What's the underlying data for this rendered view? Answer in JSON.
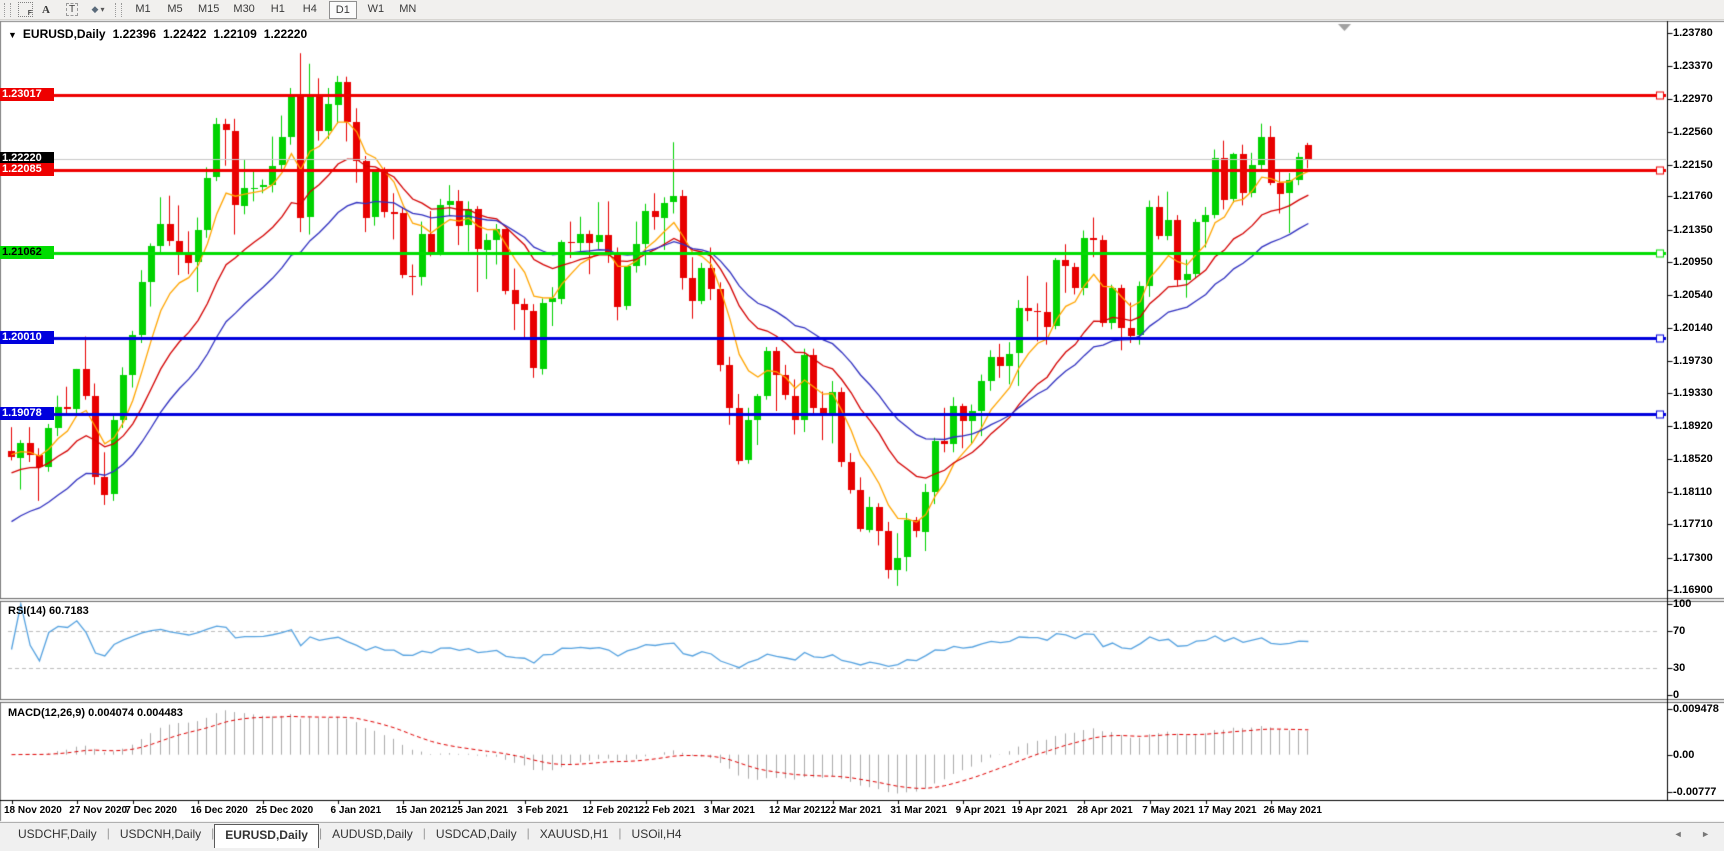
{
  "toolbar": {
    "grid_badge": "F",
    "font_tool": "A",
    "text_tool": "T",
    "shapes_glyph": "◆",
    "caret": "▾",
    "timeframes": [
      "M1",
      "M5",
      "M15",
      "M30",
      "H1",
      "H4",
      "D1",
      "W1",
      "MN"
    ],
    "active_timeframe": "D1"
  },
  "chart_header": {
    "dropdown": "▼",
    "symbol": "EURUSD,Daily",
    "open": "1.22396",
    "high": "1.22422",
    "low": "1.22109",
    "close": "1.22220"
  },
  "main_axis": {
    "ticks": [
      "1.23780",
      "1.23370",
      "1.22970",
      "1.22560",
      "1.22150",
      "1.21760",
      "1.21350",
      "1.20950",
      "1.20540",
      "1.20140",
      "1.19730",
      "1.19330",
      "1.18920",
      "1.18520",
      "1.18110",
      "1.17710",
      "1.17300",
      "1.16900"
    ]
  },
  "levels": [
    {
      "price": 1.23017,
      "label": "1.23017",
      "color": "#ee0000",
      "text_color": "#ffffff"
    },
    {
      "price": 1.22085,
      "label": "1.22085",
      "color": "#ee0000",
      "text_color": "#ffffff"
    },
    {
      "price": 1.21062,
      "label": "1.21062",
      "color": "#00dd00",
      "text_color": "#000000"
    },
    {
      "price": 1.2001,
      "label": "1.20010",
      "color": "#0000dd",
      "text_color": "#ffffff"
    },
    {
      "price": 1.19078,
      "label": "1.19078",
      "color": "#0000dd",
      "text_color": "#ffffff"
    }
  ],
  "current_price": {
    "price": 1.2222,
    "label": "1.22220",
    "line_color": "#c8c8c8",
    "bg": "#000000",
    "text_color": "#ffffff"
  },
  "rsi_panel": {
    "title": "RSI(14) 60.7183",
    "period": 14,
    "line_color": "#55a2e0",
    "level_color": "#bdbdbd",
    "ticks": [
      {
        "value": 100,
        "label": "100",
        "dashed": false
      },
      {
        "value": 70,
        "label": "70",
        "dashed": true
      },
      {
        "value": 30,
        "label": "30",
        "dashed": true
      },
      {
        "value": 0,
        "label": "0",
        "dashed": false
      }
    ]
  },
  "macd_panel": {
    "title": "MACD(12,26,9) 0.004074 0.004483",
    "fast": 12,
    "slow": 26,
    "signal": 9,
    "hist_color": "#ababab",
    "signal_color": "#e00000",
    "ticks": [
      {
        "value": 0.009478,
        "label": "0.009478"
      },
      {
        "value": 0.0,
        "label": "0.00"
      },
      {
        "value": -0.00777,
        "label": "-0.00777"
      }
    ]
  },
  "x_axis": {
    "labels": [
      {
        "text": "18 Nov 2020",
        "index": 0
      },
      {
        "text": "27 Nov 2020",
        "index": 7
      },
      {
        "text": "7 Dec 2020",
        "index": 13
      },
      {
        "text": "16 Dec 2020",
        "index": 20
      },
      {
        "text": "25 Dec 2020",
        "index": 27
      },
      {
        "text": "6 Jan 2021",
        "index": 35
      },
      {
        "text": "15 Jan 2021",
        "index": 42
      },
      {
        "text": "25 Jan 2021",
        "index": 48
      },
      {
        "text": "3 Feb 2021",
        "index": 55
      },
      {
        "text": "12 Feb 2021",
        "index": 62
      },
      {
        "text": "22 Feb 2021",
        "index": 68
      },
      {
        "text": "3 Mar 2021",
        "index": 75
      },
      {
        "text": "12 Mar 2021",
        "index": 82
      },
      {
        "text": "22 Mar 2021",
        "index": 88
      },
      {
        "text": "31 Mar 2021",
        "index": 95
      },
      {
        "text": "9 Apr 2021",
        "index": 102
      },
      {
        "text": "19 Apr 2021",
        "index": 108
      },
      {
        "text": "28 Apr 2021",
        "index": 115
      },
      {
        "text": "7 May 2021",
        "index": 122
      },
      {
        "text": "17 May 2021",
        "index": 128
      },
      {
        "text": "26 May 2021",
        "index": 135
      }
    ]
  },
  "tabs": {
    "items": [
      "USDCHF,Daily",
      "USDCNH,Daily",
      "EURUSD,Daily",
      "AUDUSD,Daily",
      "USDCAD,Daily",
      "XAUUSD,H1",
      "USOil,H4"
    ],
    "active": "EURUSD,Daily",
    "scroll_arrows": "◄ ►"
  },
  "shift_marker": "▼",
  "colors": {
    "candle_up": "#00d200",
    "candle_down": "#e80000",
    "ma_fast": "#ffa500",
    "ma_medium": "#d40000",
    "ma_slow": "#3030c0",
    "chart_bg": "#ffffff",
    "frame": "#808080"
  },
  "chart_data": {
    "type": "candlestick",
    "symbol": "EURUSD",
    "timeframe": "Daily",
    "price_axis_range": [
      1.168,
      1.23891
    ],
    "candles_ohlc": [
      [
        1.1862,
        1.1891,
        1.185,
        1.1854
      ],
      [
        1.1854,
        1.1875,
        1.1814,
        1.1872
      ],
      [
        1.1872,
        1.1891,
        1.1848,
        1.1857
      ],
      [
        1.1857,
        1.1865,
        1.18,
        1.1842
      ],
      [
        1.1842,
        1.1895,
        1.1836,
        1.189
      ],
      [
        1.189,
        1.193,
        1.188,
        1.1916
      ],
      [
        1.1916,
        1.1941,
        1.1906,
        1.1914
      ],
      [
        1.1914,
        1.1963,
        1.1908,
        1.1963
      ],
      [
        1.1963,
        1.2003,
        1.1925,
        1.193
      ],
      [
        1.193,
        1.1945,
        1.182,
        1.183
      ],
      [
        1.183,
        1.186,
        1.1795,
        1.1808
      ],
      [
        1.1808,
        1.1905,
        1.18,
        1.19
      ],
      [
        1.19,
        1.1965,
        1.189,
        1.1955
      ],
      [
        1.1955,
        1.201,
        1.194,
        1.2005
      ],
      [
        1.2005,
        1.2085,
        1.1995,
        1.207
      ],
      [
        1.207,
        1.2118,
        1.204,
        1.2115
      ],
      [
        1.2115,
        1.2175,
        1.2105,
        1.2142
      ],
      [
        1.2142,
        1.2177,
        1.2115,
        1.2121
      ],
      [
        1.2121,
        1.2165,
        1.2079,
        1.2108
      ],
      [
        1.2108,
        1.2133,
        1.208,
        1.2095
      ],
      [
        1.2095,
        1.215,
        1.2058,
        1.2135
      ],
      [
        1.2135,
        1.2212,
        1.2125,
        1.2199
      ],
      [
        1.2199,
        1.2273,
        1.2195,
        1.2265
      ],
      [
        1.2265,
        1.2272,
        1.2214,
        1.2257
      ],
      [
        1.2257,
        1.2272,
        1.2129,
        1.2165
      ],
      [
        1.2165,
        1.2221,
        1.2154,
        1.2187
      ],
      [
        1.2187,
        1.2208,
        1.217,
        1.2187
      ],
      [
        1.2187,
        1.2197,
        1.218,
        1.219
      ],
      [
        1.219,
        1.225,
        1.2181,
        1.2214
      ],
      [
        1.2214,
        1.2276,
        1.2208,
        1.2249
      ],
      [
        1.2249,
        1.231,
        1.224,
        1.2299
      ],
      [
        1.2299,
        1.2353,
        1.2132,
        1.215
      ],
      [
        1.215,
        1.234,
        1.2129,
        1.23
      ],
      [
        1.23,
        1.2322,
        1.2245,
        1.2257
      ],
      [
        1.2257,
        1.231,
        1.2247,
        1.229
      ],
      [
        1.229,
        1.2325,
        1.2266,
        1.2318
      ],
      [
        1.2318,
        1.2324,
        1.2244,
        1.2268
      ],
      [
        1.2268,
        1.2285,
        1.2193,
        1.222
      ],
      [
        1.222,
        1.2226,
        1.2132,
        1.215
      ],
      [
        1.215,
        1.2208,
        1.214,
        1.2206
      ],
      [
        1.2206,
        1.2212,
        1.215,
        1.2157
      ],
      [
        1.2157,
        1.218,
        1.2123,
        1.2155
      ],
      [
        1.2155,
        1.2163,
        1.2075,
        1.2078
      ],
      [
        1.2078,
        1.2092,
        1.2054,
        1.2077
      ],
      [
        1.2077,
        1.2145,
        1.2066,
        1.213
      ],
      [
        1.213,
        1.2158,
        1.2102,
        1.2105
      ],
      [
        1.2105,
        1.2173,
        1.2103,
        1.2166
      ],
      [
        1.2166,
        1.219,
        1.2152,
        1.2171
      ],
      [
        1.2171,
        1.2184,
        1.2116,
        1.214
      ],
      [
        1.214,
        1.217,
        1.2108,
        1.216
      ],
      [
        1.216,
        1.2164,
        1.2058,
        1.211
      ],
      [
        1.211,
        1.213,
        1.2074,
        1.2122
      ],
      [
        1.2122,
        1.2142,
        1.2092,
        1.2136
      ],
      [
        1.2136,
        1.2136,
        1.2055,
        1.206
      ],
      [
        1.206,
        1.2087,
        1.2011,
        1.2043
      ],
      [
        1.2043,
        1.205,
        1.2002,
        1.2035
      ],
      [
        1.2035,
        1.2043,
        1.1952,
        1.1964
      ],
      [
        1.1964,
        1.205,
        1.1956,
        1.2045
      ],
      [
        1.2045,
        1.2064,
        1.2016,
        1.205
      ],
      [
        1.205,
        1.2122,
        1.2043,
        1.212
      ],
      [
        1.212,
        1.2145,
        1.21,
        1.2119
      ],
      [
        1.2119,
        1.2151,
        1.2106,
        1.213
      ],
      [
        1.213,
        1.2134,
        1.208,
        1.2119
      ],
      [
        1.2119,
        1.2169,
        1.2111,
        1.2128
      ],
      [
        1.2128,
        1.217,
        1.2094,
        1.2105
      ],
      [
        1.2105,
        1.2113,
        1.2023,
        1.204
      ],
      [
        1.204,
        1.209,
        1.2036,
        1.209
      ],
      [
        1.209,
        1.2145,
        1.2082,
        1.2117
      ],
      [
        1.2117,
        1.2167,
        1.2091,
        1.2158
      ],
      [
        1.2158,
        1.218,
        1.2135,
        1.215
      ],
      [
        1.215,
        1.2175,
        1.211,
        1.2168
      ],
      [
        1.2168,
        1.2243,
        1.2155,
        1.2176
      ],
      [
        1.2176,
        1.2184,
        1.2061,
        1.2075
      ],
      [
        1.2075,
        1.2101,
        1.2025,
        1.2047
      ],
      [
        1.2047,
        1.2094,
        1.2043,
        1.2088
      ],
      [
        1.2088,
        1.2113,
        1.2048,
        1.2062
      ],
      [
        1.2062,
        1.207,
        1.196,
        1.1968
      ],
      [
        1.1968,
        1.1978,
        1.1894,
        1.1915
      ],
      [
        1.1915,
        1.1932,
        1.1845,
        1.185
      ],
      [
        1.185,
        1.1915,
        1.1846,
        1.19
      ],
      [
        1.19,
        1.1932,
        1.1869,
        1.193
      ],
      [
        1.193,
        1.199,
        1.1925,
        1.1985
      ],
      [
        1.1985,
        1.199,
        1.1911,
        1.1955
      ],
      [
        1.1955,
        1.1968,
        1.1925,
        1.193
      ],
      [
        1.193,
        1.195,
        1.1882,
        1.19
      ],
      [
        1.19,
        1.1988,
        1.1885,
        1.198
      ],
      [
        1.198,
        1.1988,
        1.1906,
        1.1915
      ],
      [
        1.1915,
        1.1935,
        1.1875,
        1.1905
      ],
      [
        1.1905,
        1.1948,
        1.1871,
        1.1935
      ],
      [
        1.1935,
        1.194,
        1.1842,
        1.1848
      ],
      [
        1.1848,
        1.1859,
        1.1809,
        1.1813
      ],
      [
        1.1813,
        1.1829,
        1.1762,
        1.1765
      ],
      [
        1.1765,
        1.1805,
        1.1761,
        1.1793
      ],
      [
        1.1793,
        1.1797,
        1.1745,
        1.1763
      ],
      [
        1.1763,
        1.1774,
        1.1704,
        1.1715
      ],
      [
        1.1715,
        1.176,
        1.1695,
        1.173
      ],
      [
        1.173,
        1.1785,
        1.1713,
        1.1776
      ],
      [
        1.1776,
        1.178,
        1.1755,
        1.1762
      ],
      [
        1.1762,
        1.1821,
        1.1738,
        1.1811
      ],
      [
        1.1811,
        1.1878,
        1.1796,
        1.1874
      ],
      [
        1.1874,
        1.1915,
        1.186,
        1.187
      ],
      [
        1.187,
        1.1928,
        1.186,
        1.1917
      ],
      [
        1.1917,
        1.192,
        1.1865,
        1.1899
      ],
      [
        1.1899,
        1.1919,
        1.187,
        1.1911
      ],
      [
        1.1911,
        1.1956,
        1.188,
        1.1948
      ],
      [
        1.1948,
        1.1986,
        1.1936,
        1.1978
      ],
      [
        1.1978,
        1.1994,
        1.1952,
        1.1967
      ],
      [
        1.1967,
        1.1996,
        1.1944,
        1.1982
      ],
      [
        1.1982,
        1.2048,
        1.1942,
        1.2038
      ],
      [
        1.2038,
        1.2078,
        1.2022,
        1.2034
      ],
      [
        1.2034,
        1.2044,
        1.1997,
        1.2033
      ],
      [
        1.2033,
        1.207,
        1.1993,
        1.2015
      ],
      [
        1.2015,
        1.21,
        1.2012,
        1.2097
      ],
      [
        1.2097,
        1.2117,
        1.2057,
        1.2089
      ],
      [
        1.2089,
        1.2094,
        1.2055,
        1.2063
      ],
      [
        1.2063,
        1.2134,
        1.2054,
        1.2125
      ],
      [
        1.2125,
        1.215,
        1.2101,
        1.2122
      ],
      [
        1.2122,
        1.2128,
        1.2015,
        1.202
      ],
      [
        1.202,
        1.2067,
        1.2012,
        1.2063
      ],
      [
        1.2063,
        1.2067,
        1.1986,
        1.2014
      ],
      [
        1.2014,
        1.2045,
        1.1995,
        1.2004
      ],
      [
        1.2004,
        1.2071,
        1.1993,
        1.2065
      ],
      [
        1.2065,
        1.2171,
        1.2052,
        1.2163
      ],
      [
        1.2163,
        1.2177,
        1.2123,
        1.2127
      ],
      [
        1.2127,
        1.2182,
        1.2122,
        1.2147
      ],
      [
        1.2147,
        1.2153,
        1.2065,
        1.2073
      ],
      [
        1.2073,
        1.2098,
        1.2051,
        1.208
      ],
      [
        1.208,
        1.2148,
        1.2075,
        1.2144
      ],
      [
        1.2144,
        1.2163,
        1.2113,
        1.2153
      ],
      [
        1.2153,
        1.2234,
        1.2149,
        1.2224
      ],
      [
        1.2224,
        1.2245,
        1.216,
        1.2172
      ],
      [
        1.2172,
        1.223,
        1.2168,
        1.2228
      ],
      [
        1.2228,
        1.224,
        1.2165,
        1.218
      ],
      [
        1.218,
        1.223,
        1.2175,
        1.2215
      ],
      [
        1.2215,
        1.2266,
        1.221,
        1.225
      ],
      [
        1.225,
        1.2263,
        1.219,
        1.2193
      ],
      [
        1.2193,
        1.221,
        1.2155,
        1.218
      ],
      [
        1.218,
        1.2205,
        1.2131,
        1.2196
      ],
      [
        1.2196,
        1.223,
        1.219,
        1.2225
      ],
      [
        1.22396,
        1.22422,
        1.22109,
        1.2222
      ]
    ],
    "moving_averages": [
      {
        "name": "ma-fast",
        "type": "ema",
        "period": 7,
        "seed": 1.1858,
        "color": "#ffa500"
      },
      {
        "name": "ma-medium",
        "type": "ema",
        "period": 16,
        "seed": 1.1832,
        "color": "#d40000"
      },
      {
        "name": "ma-slow",
        "type": "ema",
        "period": 26,
        "seed": 1.1768,
        "color": "#3030c0"
      }
    ]
  }
}
